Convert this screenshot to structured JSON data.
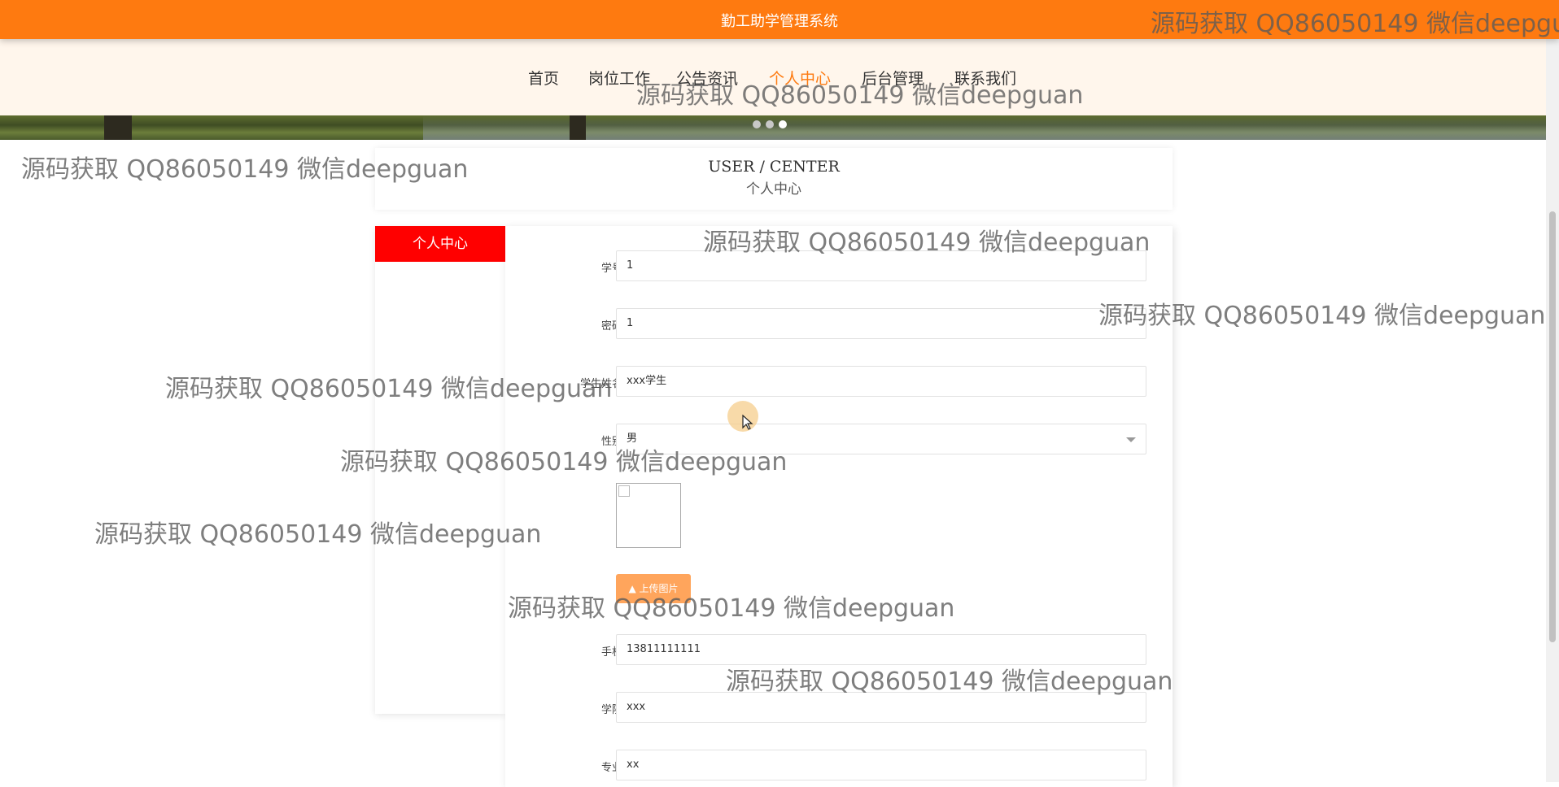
{
  "app": {
    "title": "勤工助学管理系统"
  },
  "nav": {
    "items": [
      {
        "label": "首页",
        "active": false
      },
      {
        "label": "岗位工作",
        "active": false
      },
      {
        "label": "公告资讯",
        "active": false
      },
      {
        "label": "个人中心",
        "active": true
      },
      {
        "label": "后台管理",
        "active": false
      },
      {
        "label": "联系我们",
        "active": false
      }
    ]
  },
  "carousel": {
    "slides": 3,
    "active_slide": 3
  },
  "page_head": {
    "en": "USER / CENTER",
    "cn": "个人中心"
  },
  "sidebar": {
    "items": [
      {
        "label": "个人中心"
      }
    ]
  },
  "form": {
    "student_id": {
      "label": "学号",
      "value": "1"
    },
    "password": {
      "label": "密码",
      "value": "1"
    },
    "student_name": {
      "label": "学生姓名",
      "value": "xxx学生"
    },
    "gender": {
      "label": "性别",
      "value": "男"
    },
    "upload_label": "上传图片",
    "phone": {
      "label": "手机",
      "value": "13811111111"
    },
    "college": {
      "label": "学院",
      "value": "xxx"
    },
    "major": {
      "label": "专业",
      "value": "xx"
    }
  },
  "watermarks": [
    "源码获取 QQ86050149 微信deepguan",
    "源码获取 QQ86050149 微信deepguan",
    "源码获取 QQ86050149 微信deepguan",
    "源码获取 QQ86050149 微信deepguan",
    "源码获取 QQ86050149 微信deepguan",
    "源码获取 QQ86050149 微信deepguan",
    "源码获取 QQ86050149 微信deepguan",
    "源码获取 QQ86050149 微信deepguan",
    "源码获取 QQ86050149 微信deepguan",
    "源码获取 QQ86050149 微信deepgu"
  ],
  "colors": {
    "accent": "#fe7a10",
    "sidebar_active": "#ff0000",
    "nav_bg": "#fff6ec"
  }
}
